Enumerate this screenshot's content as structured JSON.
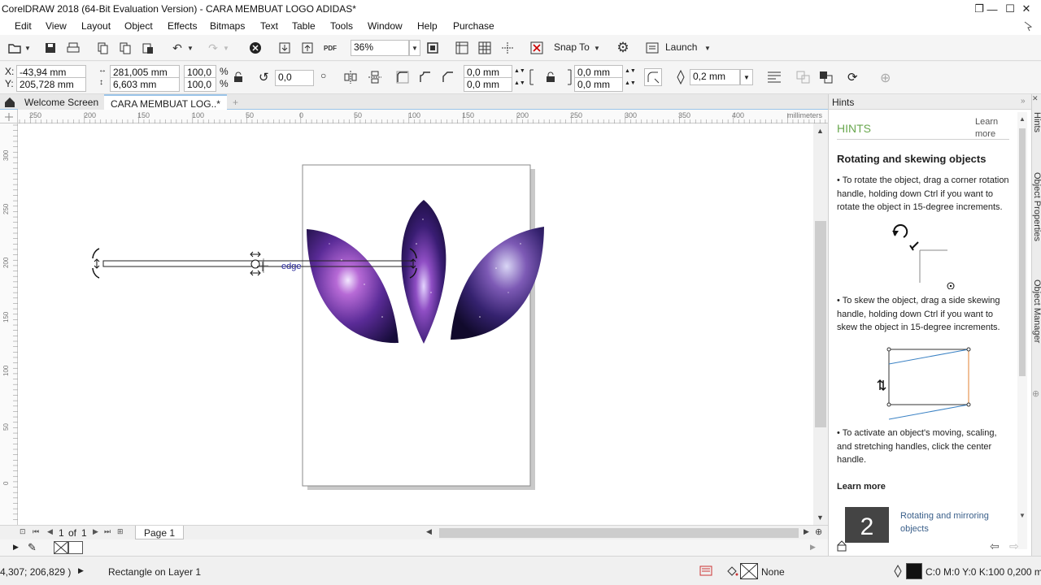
{
  "window": {
    "title": "CorelDRAW 2018 (64-Bit Evaluation Version) - CARA MEMBUAT LOGO ADIDAS*"
  },
  "menu": [
    "Edit",
    "View",
    "Layout",
    "Object",
    "Effects",
    "Bitmaps",
    "Text",
    "Table",
    "Tools",
    "Window",
    "Help",
    "Purchase"
  ],
  "toolbar": {
    "zoom": "36%",
    "snap_to": "Snap To",
    "launch": "Launch",
    "pdf_label": "PDF"
  },
  "propbar": {
    "x": "-43,94 mm",
    "y": "205,728 mm",
    "x_label": "X:",
    "y_label": "Y:",
    "width": "281,005 mm",
    "height": "6,603 mm",
    "scale_w": "100,0",
    "scale_h": "100,0",
    "pct": "%",
    "rotation": "0,0",
    "corner1": "0,0 mm",
    "corner2": "0,0 mm",
    "corner3": "0,0 mm",
    "corner4": "0,0 mm",
    "outline": "0,2 mm"
  },
  "tabs": {
    "welcome": "Welcome Screen",
    "document": "CARA MEMBUAT LOG..*",
    "add": "+"
  },
  "ruler": {
    "units": "millimeters",
    "h_ticks": [
      "250",
      "200",
      "150",
      "100",
      "50",
      "0",
      "50",
      "100",
      "150",
      "200",
      "250",
      "300",
      "350",
      "400"
    ],
    "v_ticks": [
      "300",
      "250",
      "200",
      "150",
      "100",
      "50",
      "0"
    ]
  },
  "canvas": {
    "snap_label": "edge"
  },
  "pagenav": {
    "current": "1",
    "of": "of",
    "total": "1",
    "page_tab": "Page 1"
  },
  "status": {
    "coords": "4,307; 206,829 )",
    "object": "Rectangle on Layer 1",
    "fill": "None",
    "outline": "C:0 M:0 Y:0 K:100  0,200 mm"
  },
  "hints": {
    "panel_title": "Hints",
    "heading": "HINTS",
    "learn_more_top": "Learn more",
    "title": "Rotating and skewing objects",
    "p1": "• To rotate the object, drag a corner rotation handle, holding down Ctrl if you want to rotate the object in 15-degree increments.",
    "p2": "• To skew the object, drag a side skewing handle, holding down Ctrl if you want to skew the object in 15-degree increments.",
    "p3": "• To activate an object's moving, scaling, and stretching handles, click the center handle.",
    "learn_more": "Learn more",
    "related_num": "2",
    "related": "Rotating and mirroring objects"
  },
  "dock": {
    "tab1": "Hints",
    "tab2": "Object Properties",
    "tab3": "Object Manager"
  },
  "colors": {
    "accent": "#6aa84f",
    "selection_blue": "#9bc4e8",
    "galaxy_a": "#2a1b5e",
    "galaxy_b": "#8e44ad"
  }
}
